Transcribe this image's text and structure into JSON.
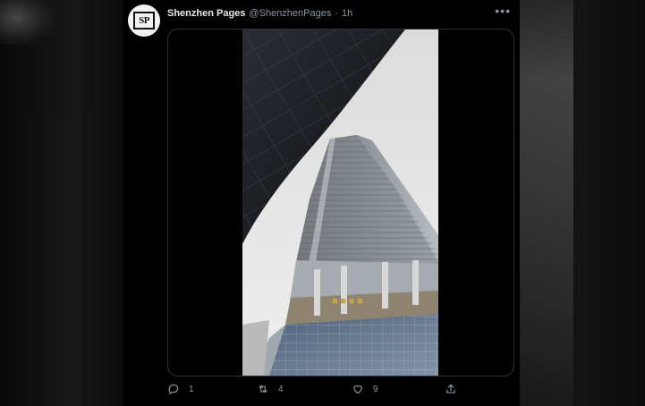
{
  "tweet": {
    "author": {
      "display_name": "Shenzhen Pages",
      "handle": "@ShenzhenPages",
      "avatar_text": "SP"
    },
    "separator": "·",
    "time": "1h",
    "more_icon": "ellipsis-icon",
    "stats": {
      "replies": "1",
      "retweets": "4",
      "likes": "9"
    },
    "icons": {
      "reply": "comment-icon",
      "retweet": "retweet-icon",
      "like": "heart-icon",
      "share": "share-icon"
    }
  },
  "colors": {
    "background": "#000000",
    "primary_text": "#e7e9ea",
    "secondary_text": "#8b98a5",
    "border": "#2f3336"
  }
}
